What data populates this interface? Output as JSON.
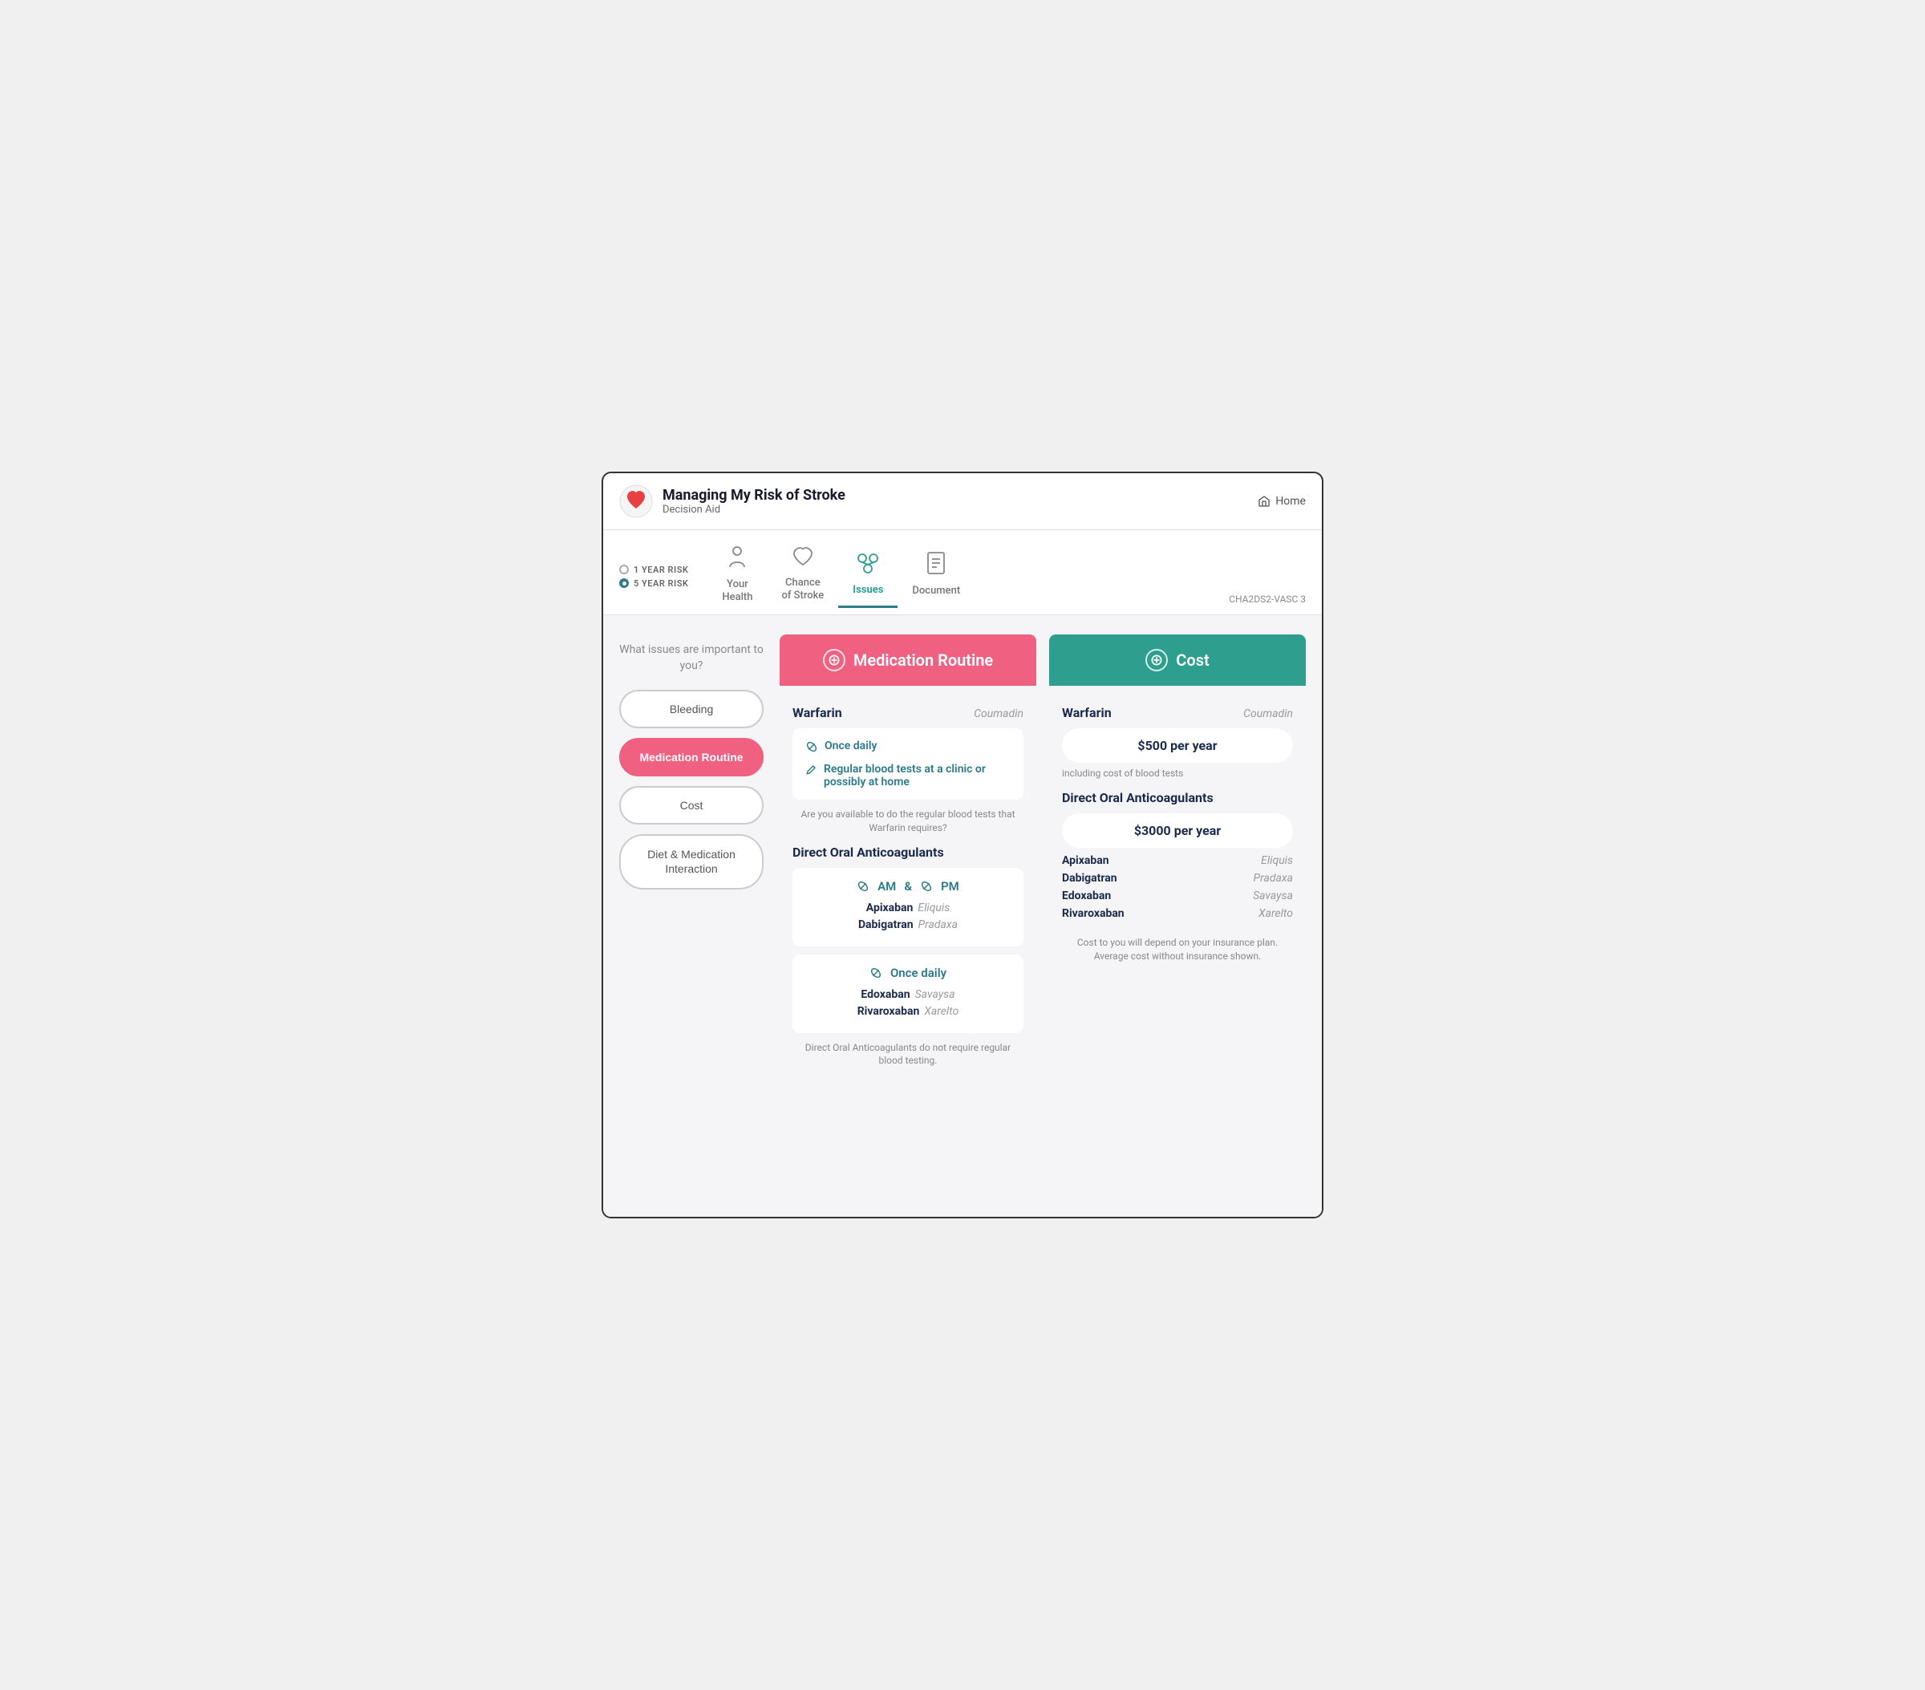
{
  "header": {
    "title": "Managing My Risk of Stroke",
    "subtitle": "Decision Aid",
    "home_label": "Home"
  },
  "nav": {
    "risk_options": [
      {
        "label": "1 YEAR RISK",
        "active": false
      },
      {
        "label": "5 YEAR RISK",
        "active": true
      }
    ],
    "tabs": [
      {
        "label": "Your\nHealth",
        "icon": "👤",
        "active": false
      },
      {
        "label": "Chance\nof Stroke",
        "icon": "🫀",
        "active": false
      },
      {
        "label": "Issues",
        "icon": "🔀",
        "active": true
      },
      {
        "label": "Document",
        "icon": "📋",
        "active": false
      }
    ],
    "cha_score": "CHA2DS2-VASC 3"
  },
  "sidebar": {
    "question": "What issues are important to you?",
    "buttons": [
      {
        "label": "Bleeding",
        "active": false
      },
      {
        "label": "Medication Routine",
        "active": true
      },
      {
        "label": "Cost",
        "active": false
      },
      {
        "label": "Diet & Medication Interaction",
        "active": false
      }
    ]
  },
  "med_routine_column": {
    "header": "Medication Routine",
    "warfarin_name": "Warfarin",
    "warfarin_brand": "Coumadin",
    "warfarin_details": [
      {
        "icon": "💊",
        "text": "Once daily"
      },
      {
        "icon": "✏️",
        "text": "Regular blood tests at a clinic or possibly at home"
      }
    ],
    "warfarin_footnote": "Are you available to do the regular blood tests that Warfarin requires?",
    "doac_title": "Direct Oral Anticoagulants",
    "doac_twice_daily_header": "AM  &  PM",
    "doac_twice": [
      {
        "name": "Apixaban",
        "brand": "Eliquis"
      },
      {
        "name": "Dabigatran",
        "brand": "Pradaxa"
      }
    ],
    "doac_once_daily_header": "Once daily",
    "doac_once": [
      {
        "name": "Edoxaban",
        "brand": "Savaysa"
      },
      {
        "name": "Rivaroxaban",
        "brand": "Xarelto"
      }
    ],
    "doac_footnote": "Direct Oral Anticoagulants do not require regular blood testing."
  },
  "cost_column": {
    "header": "Cost",
    "warfarin_name": "Warfarin",
    "warfarin_brand": "Coumadin",
    "warfarin_cost": "$500 per year",
    "warfarin_cost_note": "including cost of blood tests",
    "doac_title": "Direct Oral Anticoagulants",
    "doac_cost": "$3000 per year",
    "doac_drugs": [
      {
        "name": "Apixaban",
        "brand": "Eliquis"
      },
      {
        "name": "Dabigatran",
        "brand": "Pradaxa"
      },
      {
        "name": "Edoxaban",
        "brand": "Savaysa"
      },
      {
        "name": "Rivaroxaban",
        "brand": "Xarelto"
      }
    ],
    "footnote": "Cost to you will depend on your insurance plan. Average cost without insurance shown."
  }
}
